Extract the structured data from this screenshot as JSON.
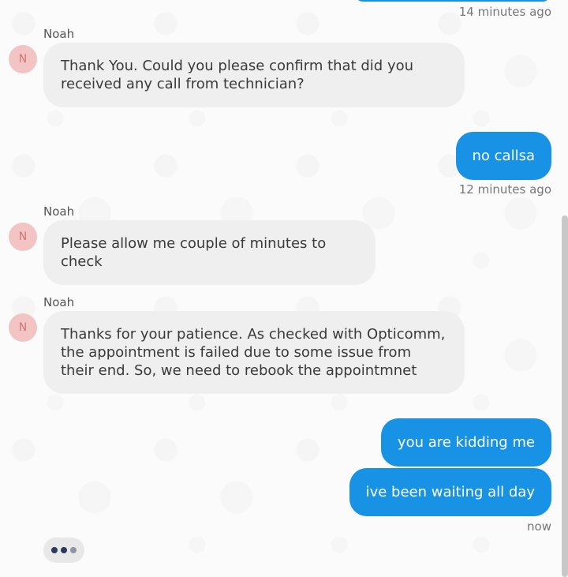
{
  "messages": [
    {
      "time": "14 minutes ago"
    },
    {
      "sender": "Noah",
      "avatar_initial": "N",
      "text": "Thank You. Could you please confirm that did you received any call from technician?"
    },
    {
      "text": "no callsa",
      "time": "12 minutes ago"
    },
    {
      "sender": "Noah",
      "avatar_initial": "N",
      "text": "Please allow me couple of minutes to check"
    },
    {
      "sender": "Noah",
      "avatar_initial": "N",
      "text": "Thanks for your patience. As checked with Opticomm, the appointment is failed due to some issue from their end. So, we need to rebook the appointmnet"
    },
    {
      "text": "you are kidding me"
    },
    {
      "text": "ive been waiting all day",
      "time": "now"
    }
  ],
  "colors": {
    "user_bubble": "#1792e5",
    "agent_bubble": "#efefef",
    "avatar_bg": "#f2c4c4",
    "avatar_text": "#d07575"
  }
}
